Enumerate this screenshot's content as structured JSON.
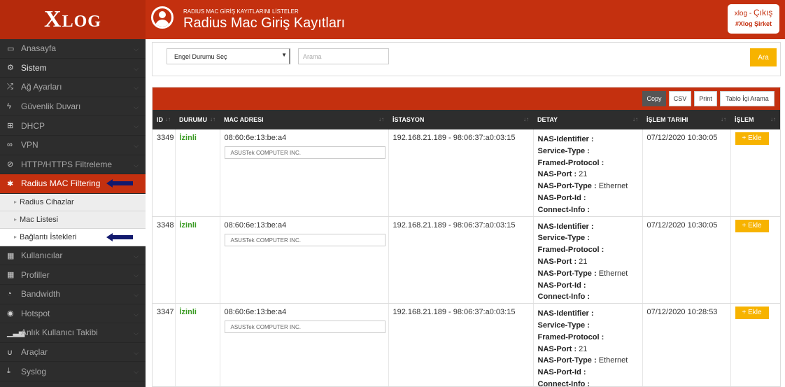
{
  "app": {
    "logo_big": "X",
    "logo_small": "LOG"
  },
  "header": {
    "subtitle": "RADIUS MAC GİRİŞ KAYITLARINI LİSTELER",
    "title": "Radius Mac Giriş Kayıtları",
    "user": "xlog",
    "separator": "-",
    "logout": "Çıkış",
    "company": "#Xlog Şirket",
    "accent_color": "#c4300f"
  },
  "sidebar": {
    "items": [
      {
        "label": "Anasayfa",
        "icon": "monitor-icon"
      },
      {
        "label": "Sistem",
        "icon": "gears-icon"
      },
      {
        "label": "Ağ Ayarları",
        "icon": "shuffle-icon"
      },
      {
        "label": "Güvenlik Duvarı",
        "icon": "bolt-icon"
      },
      {
        "label": "DHCP",
        "icon": "sitemap-icon"
      },
      {
        "label": "VPN",
        "icon": "binoculars-icon"
      },
      {
        "label": "HTTP/HTTPS Filtreleme",
        "icon": "eye-slash-icon"
      },
      {
        "label": "Radius MAC Filtering",
        "icon": "asterisk-icon"
      },
      {
        "label": "Kullanıcılar",
        "icon": "grid-icon"
      },
      {
        "label": "Profiller",
        "icon": "grid-icon"
      },
      {
        "label": "Bandwidth",
        "icon": "dashboard-icon"
      },
      {
        "label": "Hotspot",
        "icon": "globe-icon"
      },
      {
        "label": "Anlık Kullanıcı Takibi",
        "icon": "signal-icon"
      },
      {
        "label": "Araçlar",
        "icon": "magnet-icon"
      },
      {
        "label": "Syslog",
        "icon": "download-icon"
      }
    ],
    "subitems": [
      {
        "label": "Radius Cihazlar"
      },
      {
        "label": "Mac Listesi"
      },
      {
        "label": "Bağlantı İstekleri"
      }
    ]
  },
  "filter": {
    "select_value": "Engel Durumu Seç",
    "search_placeholder": "Arama",
    "search_button": "Ara"
  },
  "table_buttons": {
    "copy": "Copy",
    "csv": "CSV",
    "print": "Print",
    "search": "Tablo İçi Arama"
  },
  "table": {
    "columns": [
      "ID",
      "DURUMU",
      "MAC ADRESI",
      "İSTASYON",
      "DETAY",
      "İŞLEM TARIHI",
      "İŞLEM"
    ],
    "detail_labels": [
      "NAS-Identifier :",
      "Service-Type :",
      "Framed-Protocol :",
      "NAS-Port :",
      "NAS-Port-Type :",
      "NAS-Port-Id :",
      "Connect-Info :"
    ],
    "action_label": "+ Ekle",
    "rows": [
      {
        "id": "3349",
        "status": "İzinli",
        "mac": "08:60:6e:13:be:a4",
        "vendor": "ASUSTek COMPUTER INC.",
        "station": "192.168.21.189 - 98:06:37:a0:03:15",
        "nas_port": "21",
        "nas_port_type": "Ethernet",
        "date": "07/12/2020 10:30:05"
      },
      {
        "id": "3348",
        "status": "İzinli",
        "mac": "08:60:6e:13:be:a4",
        "vendor": "ASUSTek COMPUTER INC.",
        "station": "192.168.21.189 - 98:06:37:a0:03:15",
        "nas_port": "21",
        "nas_port_type": "Ethernet",
        "date": "07/12/2020 10:30:05"
      },
      {
        "id": "3347",
        "status": "İzinli",
        "mac": "08:60:6e:13:be:a4",
        "vendor": "ASUSTek COMPUTER INC.",
        "station": "192.168.21.189 - 98:06:37:a0:03:15",
        "nas_port": "21",
        "nas_port_type": "Ethernet",
        "date": "07/12/2020 10:28:53"
      }
    ]
  }
}
